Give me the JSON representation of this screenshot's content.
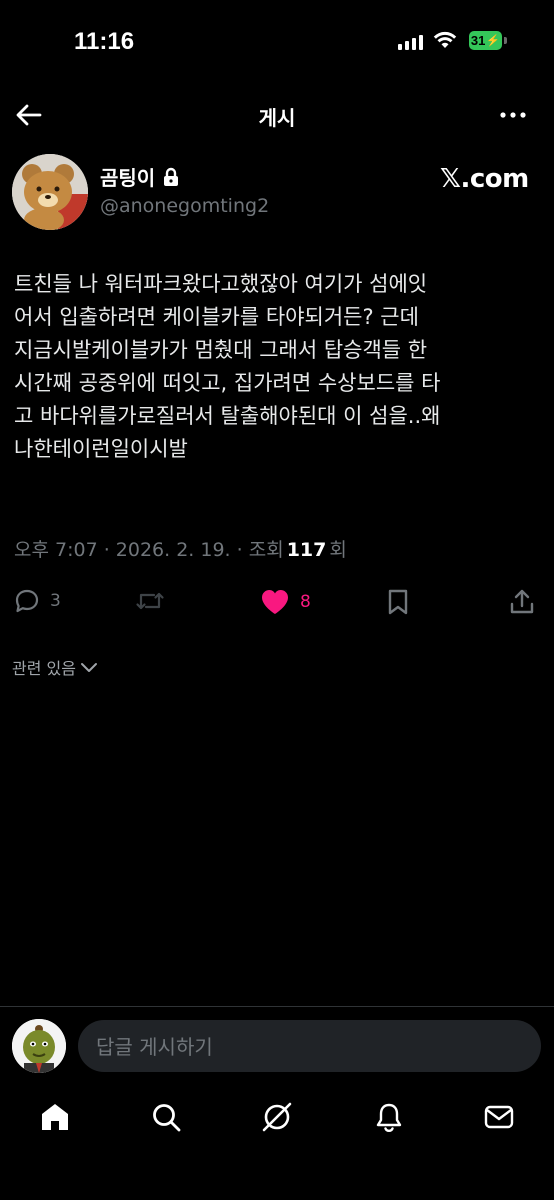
{
  "status_bar": {
    "time": "11:16",
    "battery": "31"
  },
  "nav": {
    "title": "게시"
  },
  "post": {
    "author_name": "곰팅이",
    "handle": "@anonegomting2",
    "source": "𝕏.com",
    "text": "트친들 나 워터파크왔다고했잖아 여기가 섬에잇\n어서 입출하려면 케이블카를 타야되거든? 근데\n지금시발케이블카가 멈췄대 그래서 탑승객들 한\n시간째 공중위에 떠잇고, 집가려면 수상보드를 타\n고 바다위를가로질러서 탈출해야된대 이 섬을..왜\n나한테이런일이시발",
    "timestamp": "오후 7:07 · 2026. 2. 19. · 조회",
    "views": "117",
    "views_suffix": "회"
  },
  "actions": {
    "reply_count": "3",
    "like_count": "8",
    "like_color": "#f91880"
  },
  "related_label": "관련 있음",
  "reply": {
    "placeholder": "답글 게시하기"
  },
  "tabs": [
    "home-icon",
    "search-icon",
    "grok-icon",
    "notifications-icon",
    "messages-icon"
  ]
}
